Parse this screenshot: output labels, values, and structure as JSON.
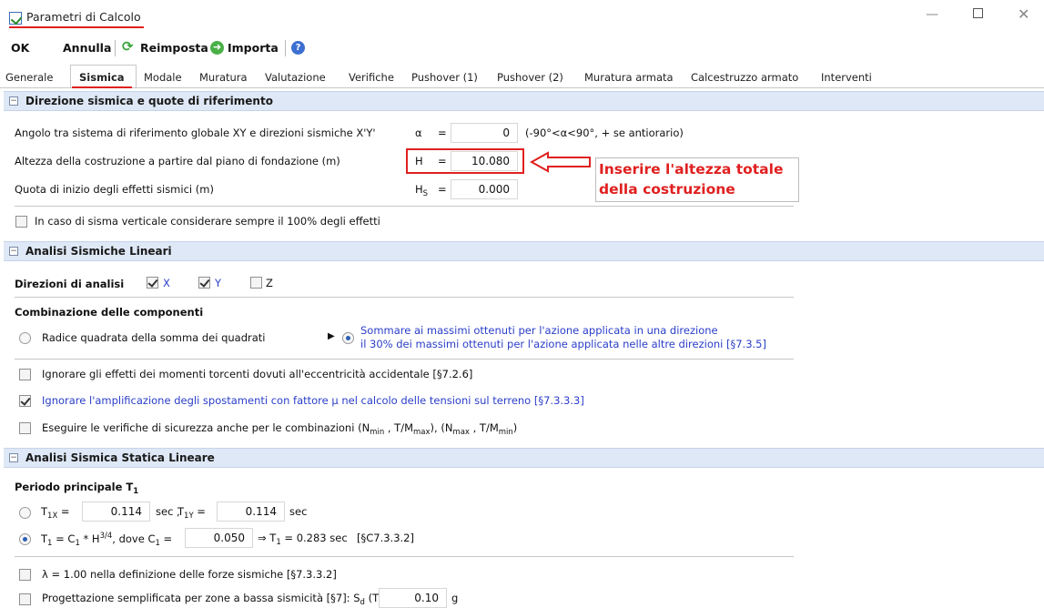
{
  "window": {
    "title": "Parametri di Calcolo"
  },
  "toolbar": {
    "ok": "OK",
    "annulla": "Annulla",
    "reimposta": "Reimposta",
    "importa": "Importa"
  },
  "tabs": [
    "Generale",
    "Sismica",
    "Modale",
    "Muratura",
    "Valutazione",
    "Verifiche",
    "Pushover (1)",
    "Pushover (2)",
    "Muratura armata",
    "Calcestruzzo armato",
    "Interventi"
  ],
  "active_tab": "Sismica",
  "sec1": {
    "title": "Direzione sismica e quote di riferimento",
    "angolo_label": "Angolo tra sistema di riferimento globale XY e direzioni sismiche X'Y'",
    "alpha_sym": "α",
    "eq": "=",
    "alpha_value": "0",
    "alpha_hint": "(-90°<α<90°, + se antiorario)",
    "altezza_label": "Altezza della costruzione a partire dal piano di fondazione (m)",
    "H_sym": "H",
    "H_value": "10.080",
    "quota_label": "Quota di inizio degli effetti sismici (m)",
    "Hs_sym": "H",
    "Hs_sub": "S",
    "Hs_value": "0.000",
    "sisma_vert_label": "In caso di sisma verticale considerare sempre il 100% degli effetti",
    "sisma_vert_checked": false,
    "note_line1": "Inserire l'altezza totale",
    "note_line2": "della costruzione"
  },
  "sec2": {
    "title": "Analisi Sismiche Lineari",
    "direzioni_label": "Direzioni di analisi",
    "dir_x": "X",
    "dir_y": "Y",
    "dir_z": "Z",
    "dir_x_checked": true,
    "dir_y_checked": true,
    "dir_z_checked": false,
    "combinazione_label": "Combinazione delle componenti",
    "radice_label": "Radice quadrata della somma dei quadrati",
    "sommare_line1": "Sommare ai massimi ottenuti per l'azione applicata in una direzione",
    "sommare_line2": "il 30% dei massimi ottenuti per l'azione applicata nelle altre direzioni [§7.3.5]",
    "ignora_torc_label": "Ignorare gli effetti dei momenti torcenti dovuti all'eccentricità accidentale [§7.2.6]",
    "ignora_torc_checked": false,
    "ignora_ampl_label": "Ignorare l'amplificazione degli spostamenti con fattore μ nel calcolo delle tensioni sul terreno [§7.3.3.3]",
    "ignora_ampl_checked": true,
    "eseguire_label": "Eseguire le verifiche di sicurezza anche per le combinazioni",
    "eseguire_formula": "(Nmin , T/Mmax), (Nmax , T/Mmin)",
    "eseguire_checked": false
  },
  "sec3": {
    "title": "Analisi Sismica Statica Lineare",
    "periodo_label": "Periodo principale T",
    "periodo_sub": "1",
    "t1x_label": "T",
    "t1x_sub": "1X",
    "t1x_value": "0.114",
    "sec": "sec",
    "t1y_label": "T",
    "t1y_sub": "1Y",
    "t1y_value": "0.114",
    "formula_prefix": "T",
    "formula_mid": " * H",
    "formula_exp": "3/4",
    "formula_dove": ", dove C",
    "c1_value": "0.050",
    "t1_result": "⇒ T",
    "t1_result_value": " = 0.283 sec",
    "t1_ref": "[§C7.3.3.2]",
    "lambda_label": "λ = 1.00 nella definizione delle forze sismiche [§7.3.3.2]",
    "lambda_checked": false,
    "progett_label": "Progettazione semplificata per zone a bassa sismicità [§7]: S",
    "progett_mid": "(T",
    "progett_value": "0.10",
    "progett_unit": "g",
    "progett_checked": false
  }
}
